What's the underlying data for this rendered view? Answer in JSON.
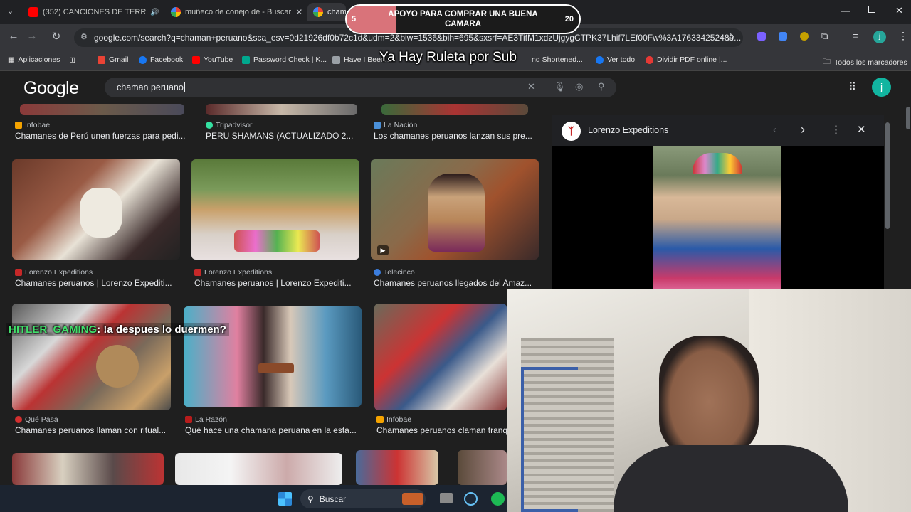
{
  "browser": {
    "tabs": [
      {
        "label": "(352) CANCIONES DE TERR",
        "favicon": "youtube-icon"
      },
      {
        "label": "muñeco de conejo de - Buscar",
        "favicon": "google-icon"
      },
      {
        "label": "chama",
        "favicon": "google-icon"
      }
    ],
    "url": "google.com/search?q=chaman+peruano&sca_esv=0d21926df0b72c1d&udm=2&biw=1536&bih=695&sxsrf=AE3TifM1xdzUjgygCTPK37Lhif7LEf00Fw%3A176334252489...",
    "bookmarks": [
      {
        "label": "Aplicaciones",
        "icon": "apps-grid-icon"
      },
      {
        "label": "Gmail",
        "icon": "gmail-icon",
        "color": "#ea4335"
      },
      {
        "label": "Facebook",
        "icon": "facebook-icon",
        "color": "#1877f2"
      },
      {
        "label": "YouTube",
        "icon": "youtube-icon",
        "color": "#ff0000"
      },
      {
        "label": "Password Check | K...",
        "icon": "kaspersky-icon",
        "color": "#00a88e"
      },
      {
        "label": "Have I Been...",
        "icon": "hibp-icon",
        "color": "#9aa0a6"
      },
      {
        "label": "nd Shortened...",
        "icon": "link-icon",
        "color": "#9aa0a6"
      },
      {
        "label": "Ver todo",
        "icon": "facebook-icon",
        "color": "#1877f2"
      },
      {
        "label": "Dividir PDF online |...",
        "icon": "pdf-icon",
        "color": "#e53935"
      },
      {
        "label": "Todos los marcadores",
        "icon": "folder-icon"
      }
    ]
  },
  "google": {
    "logo": "Google",
    "query": "chaman peruano"
  },
  "results": [
    {
      "source": "Infobae",
      "title": "Chamanes de Perú unen fuerzas para pedi...",
      "src_color": "#f4a300"
    },
    {
      "source": "Tripadvisor",
      "title": "PERU SHAMANS (ACTUALIZADO 2...",
      "src_color": "#34e0a1"
    },
    {
      "source": "La Nación",
      "title": "Los chamanes peruanos lanzan sus pre...",
      "src_color": "#4a90d9"
    },
    {
      "source": "Lorenzo Expeditions",
      "title": "Chamanes peruanos | Lorenzo Expediti...",
      "src_color": "#c62828"
    },
    {
      "source": "Lorenzo Expeditions",
      "title": "Chamanes peruanos | Lorenzo Expediti...",
      "src_color": "#c62828"
    },
    {
      "source": "Telecinco",
      "title": "Chamanes peruanos llegados del Amaz...",
      "src_color": "#3b7ddd"
    },
    {
      "source": "Qué Pasa",
      "title": "Chamanes peruanos llaman con ritual...",
      "src_color": "#d32f2f"
    },
    {
      "source": "La Razón",
      "title": "Qué hace una chamana peruana en la esta...",
      "src_color": "#b71c1c"
    },
    {
      "source": "Infobae",
      "title": "Chamanes peruanos claman tranq",
      "src_color": "#f4a300"
    }
  ],
  "panel": {
    "source": "Lorenzo Expeditions"
  },
  "taskbar": {
    "search_label": "Buscar"
  },
  "overlay": {
    "banner_left": "5",
    "banner_text": "APOYO PARA COMPRAR UNA BUENA CAMARA",
    "banner_right": "20",
    "chat_user": "HITLER_GAMING",
    "chat_message": ": !a despues lo duermen?",
    "ticker": "Ya Hay Ruleta por Sub"
  }
}
